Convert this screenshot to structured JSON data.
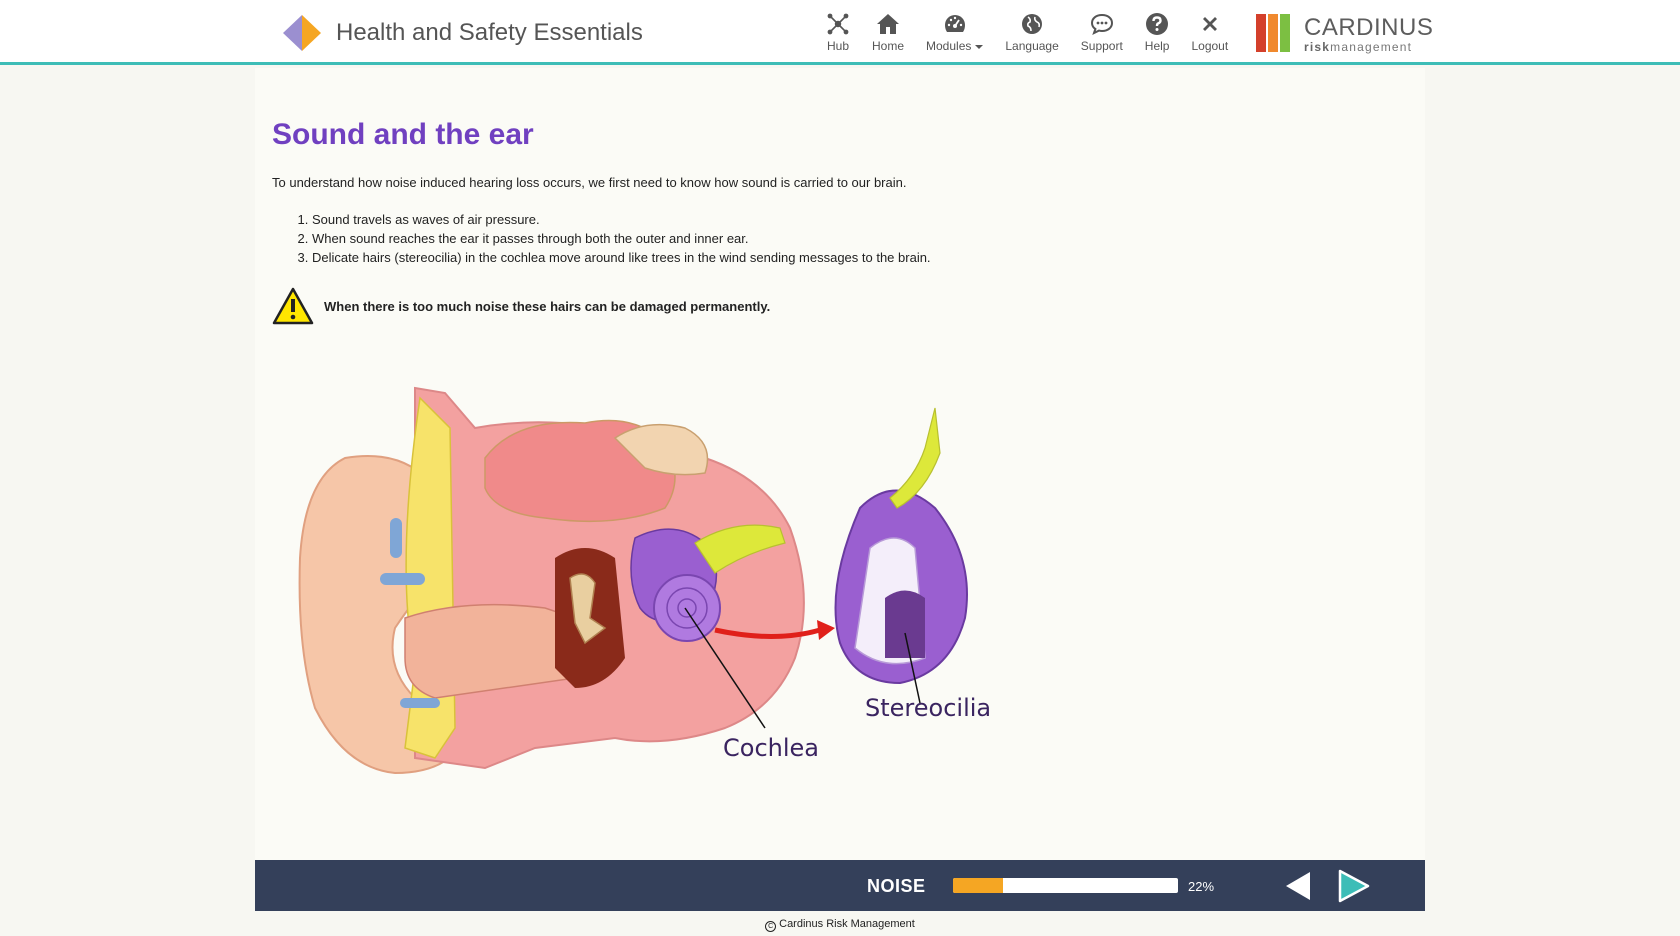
{
  "header": {
    "title": "Health and Safety Essentials",
    "nav": [
      {
        "label": "Hub",
        "icon": "hub-icon"
      },
      {
        "label": "Home",
        "icon": "home-icon"
      },
      {
        "label": "Modules",
        "icon": "dashboard-icon"
      },
      {
        "label": "Language",
        "icon": "globe-icon"
      },
      {
        "label": "Support",
        "icon": "chat-icon"
      },
      {
        "label": "Help",
        "icon": "question-icon"
      },
      {
        "label": "Logout",
        "icon": "close-icon"
      }
    ],
    "company": {
      "name": "CARDINUS",
      "sub_bold": "risk",
      "sub_rest": "management"
    }
  },
  "content": {
    "title": "Sound and the ear",
    "intro": "To understand how noise induced hearing loss occurs, we first need to know how sound is carried to our brain.",
    "steps": [
      "Sound travels as waves of air pressure.",
      "When sound reaches the ear it passes through both the outer and inner ear.",
      "Delicate hairs (stereocilia) in the cochlea move around like trees in the wind sending messages to the brain."
    ],
    "warning": "When there is too much noise these hairs can be damaged permanently.",
    "diagram_labels": {
      "cochlea": "Cochlea",
      "stereocilia": "Stereocilia"
    }
  },
  "footer": {
    "module": "NOISE",
    "progress_percent": 22,
    "progress_text": "22%",
    "copyright": "Cardinus Risk Management"
  },
  "colors": {
    "accent": "#3dbdb7",
    "title_purple": "#7040c0",
    "footer_bg": "#34405a",
    "progress": "#f5a623",
    "next_arrow": "#3dbdb7"
  }
}
